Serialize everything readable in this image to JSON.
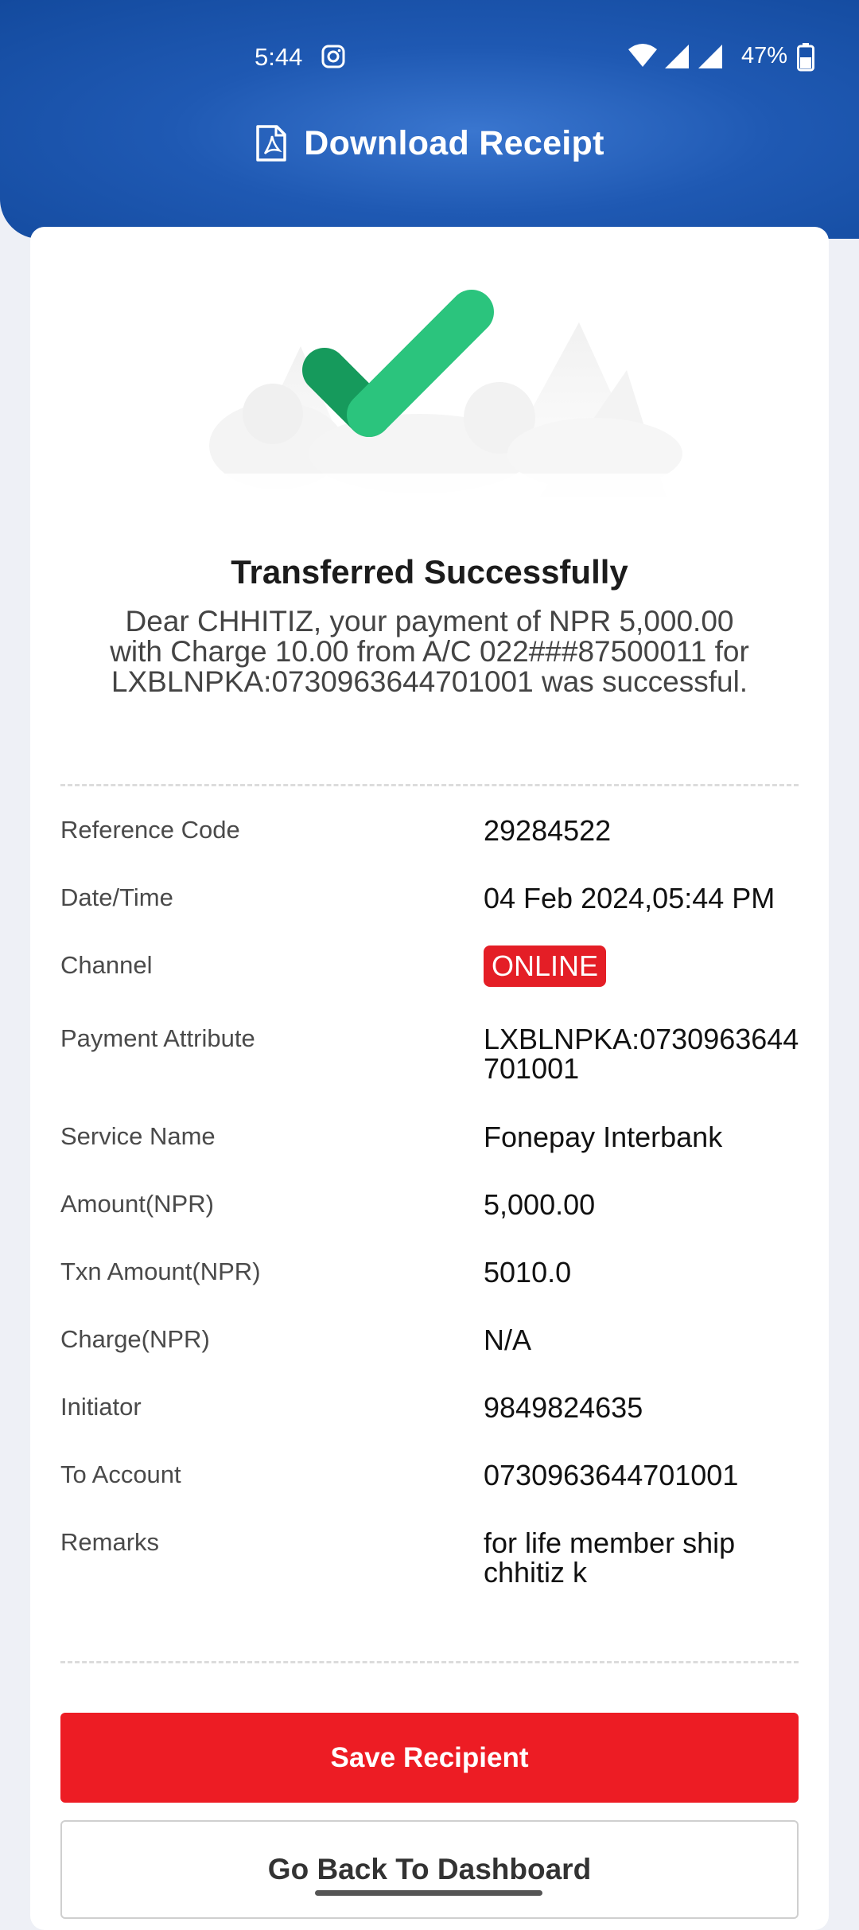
{
  "status_bar": {
    "time": "5:44",
    "battery": "47%",
    "icons": [
      "instagram-icon",
      "wifi-icon",
      "signal-icon",
      "signal-icon",
      "battery-icon"
    ]
  },
  "header": {
    "title": "Download Receipt",
    "icon": "pdf-download-icon",
    "color": "#1f59b3"
  },
  "receipt": {
    "title": "Transferred Successfully",
    "message": "Dear CHHITIZ, your payment of NPR 5,000.00 with Charge 10.00 from A/C 022###87500011 for LXBLNPKA:0730963644701001 was successful.",
    "illustration_icon": "success-checkmark-icon",
    "details": [
      {
        "label": "Reference Code",
        "value": "29284522"
      },
      {
        "label": "Date/Time",
        "value": "04 Feb 2024,05:44 PM"
      },
      {
        "label": "Channel",
        "value": "ONLINE"
      },
      {
        "label": "Payment Attribute",
        "value": "LXBLNPKA:0730963644701001"
      },
      {
        "label": "Service Name",
        "value": "Fonepay Interbank"
      },
      {
        "label": "Amount(NPR)",
        "value": "5,000.00"
      },
      {
        "label": "Txn Amount(NPR)",
        "value": "5010.0"
      },
      {
        "label": "Charge(NPR)",
        "value": "N/A"
      },
      {
        "label": "Initiator",
        "value": "9849824635"
      },
      {
        "label": "To Account",
        "value": "0730963644701001"
      },
      {
        "label": "Remarks",
        "value": "for life member ship chhitiz k"
      }
    ]
  },
  "actions": {
    "save_label": "Save Recipient",
    "dashboard_label": "Go Back To Dashboard"
  },
  "colors": {
    "accent_red": "#ed1c24",
    "badge_red": "#e41e26",
    "success_green": "#2bc47d",
    "header_blue": "#1f59b3"
  }
}
